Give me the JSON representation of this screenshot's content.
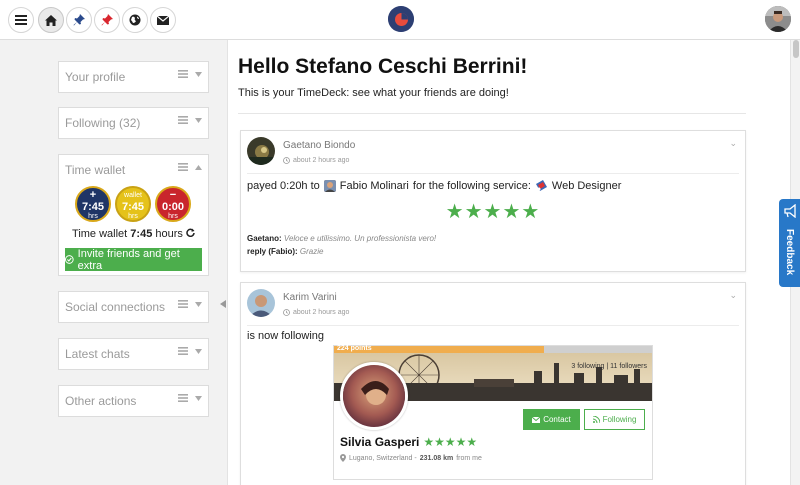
{
  "nav": {
    "menu_icon": "hamburger-icon",
    "home_icon": "home-icon",
    "pin_blue_icon": "pin-icon",
    "pin_red_icon": "pin-icon",
    "globe_icon": "globe-icon",
    "mail_icon": "envelope-icon"
  },
  "sidebar": {
    "panels": [
      {
        "title": "Your profile"
      },
      {
        "title": "Following (32)"
      },
      {
        "title": "Time wallet"
      },
      {
        "title": "Social connections"
      },
      {
        "title": "Latest chats"
      },
      {
        "title": "Other actions"
      }
    ],
    "wallet": {
      "plus": {
        "sign": "+",
        "value": "7:45",
        "unit": "hrs",
        "color": "#1f3566"
      },
      "wallet": {
        "sign": "wallet",
        "value": "7:45",
        "unit": "hrs",
        "color": "#e5c21a"
      },
      "minus": {
        "sign": "−",
        "value": "0:00",
        "unit": "hrs",
        "color": "#c9252c"
      },
      "summary_label": "Time wallet",
      "summary_value": "7:45",
      "summary_unit": "hours"
    },
    "invite_button": "Invite friends and get extra"
  },
  "main": {
    "greeting": "Hello Stefano Ceschi Berrini!",
    "subtitle": "This is your TimeDeck: see what your friends are doing!"
  },
  "feed": [
    {
      "name": "Gaetano Biondo",
      "time": "about 2 hours ago",
      "text_pre": "payed 0:20h to",
      "person": "Fabio Molinari",
      "text_mid": "for the following service:",
      "service": "Web Designer",
      "stars": "★★★★★",
      "comment_author": "Gaetano:",
      "comment_text": "Veloce e utilissimo. Un professionista vero!",
      "reply_author": "reply (Fabio):",
      "reply_text": "Grazie"
    },
    {
      "name": "Karim Varini",
      "time": "about 2 hours ago",
      "text": "is now following",
      "profile": {
        "points": "224 points",
        "points_fraction": 0.66,
        "stats": "3 following | 11 followers",
        "name": "Silvia Gasperi",
        "stars": "★★★★★",
        "location_pre": "Lugano, Switzerland -",
        "distance": "231.08 km",
        "location_post": "from me",
        "contact_label": "Contact",
        "following_label": "Following"
      }
    }
  ],
  "feedback_label": "Feedback",
  "colors": {
    "green": "#4cae4c",
    "feedback_blue": "#2878c8",
    "points_orange": "#f0ad4e"
  }
}
